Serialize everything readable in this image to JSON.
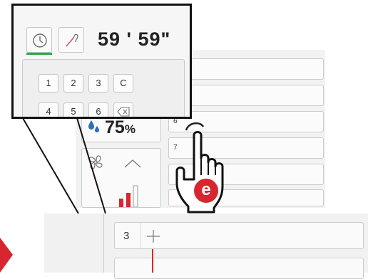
{
  "callout": {
    "timer_display": "59 ' 59\"",
    "keypad_keys": [
      "1",
      "2",
      "3",
      "C",
      "4",
      "5",
      "6"
    ]
  },
  "panel": {
    "humidity_value": "75",
    "humidity_unit": "%",
    "row_numbers": [
      "6",
      "7"
    ]
  },
  "gesture": {
    "step_label": "e"
  },
  "bottom": {
    "row_number": "3"
  },
  "colors": {
    "accent": "#d7262f",
    "active_underline": "#2aa64b",
    "humidity_drop": "#2b6fb6"
  },
  "icons": [
    "clock-icon",
    "probe-icon",
    "backspace-icon",
    "fan-icon",
    "chevron-up-icon",
    "plus-icon",
    "hand-pointer-icon",
    "arrow-right-icon"
  ]
}
